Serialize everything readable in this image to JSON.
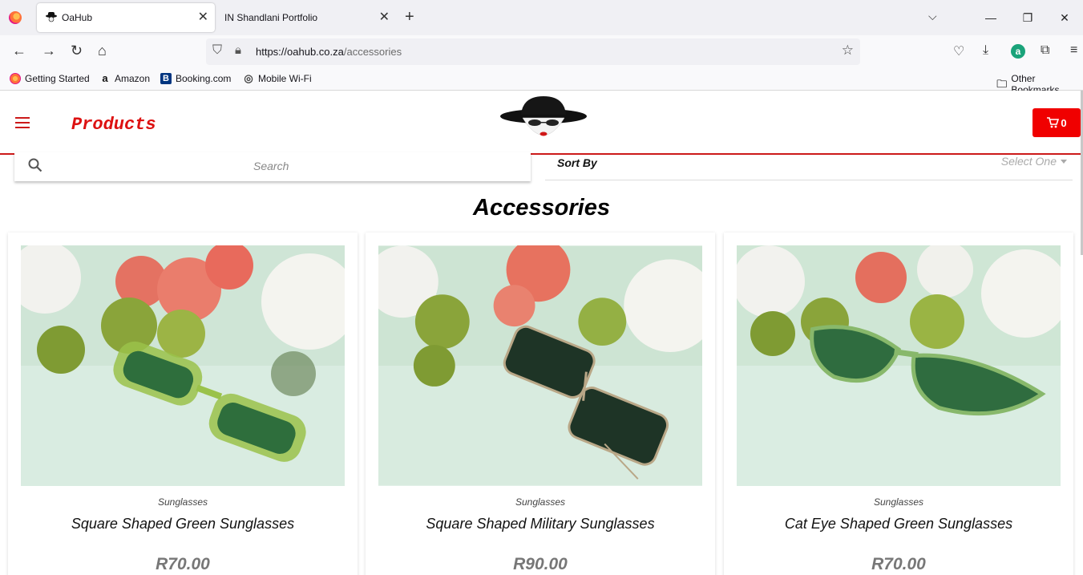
{
  "browser": {
    "tabs": [
      {
        "label": "OaHub",
        "active": true
      },
      {
        "label": "IN Shandlani Portfolio",
        "active": false
      }
    ],
    "url_host": "https://oahub.co.za",
    "url_path": "/accessories",
    "bookmarks": [
      {
        "label": "Getting Started",
        "icon": "firefox-icon"
      },
      {
        "label": "Amazon",
        "icon": "amazon-icon"
      },
      {
        "label": "Booking.com",
        "icon": "booking-icon"
      },
      {
        "label": "Mobile Wi-Fi",
        "icon": "globe-icon"
      }
    ],
    "other_bookmarks": "Other Bookmarks",
    "extension_letter": "a"
  },
  "site": {
    "brand": "Products",
    "cart_count": "0",
    "search_placeholder": "Search",
    "sort_label": "Sort By",
    "sort_value": "Select One",
    "page_title": "Accessories",
    "accent_color": "#f00000"
  },
  "products": [
    {
      "category": "Sunglasses",
      "name": "Square Shaped Green Sunglasses",
      "price": "R70.00"
    },
    {
      "category": "Sunglasses",
      "name": "Square Shaped Military Sunglasses",
      "price": "R90.00"
    },
    {
      "category": "Sunglasses",
      "name": "Cat Eye Shaped Green Sunglasses",
      "price": "R70.00"
    }
  ]
}
